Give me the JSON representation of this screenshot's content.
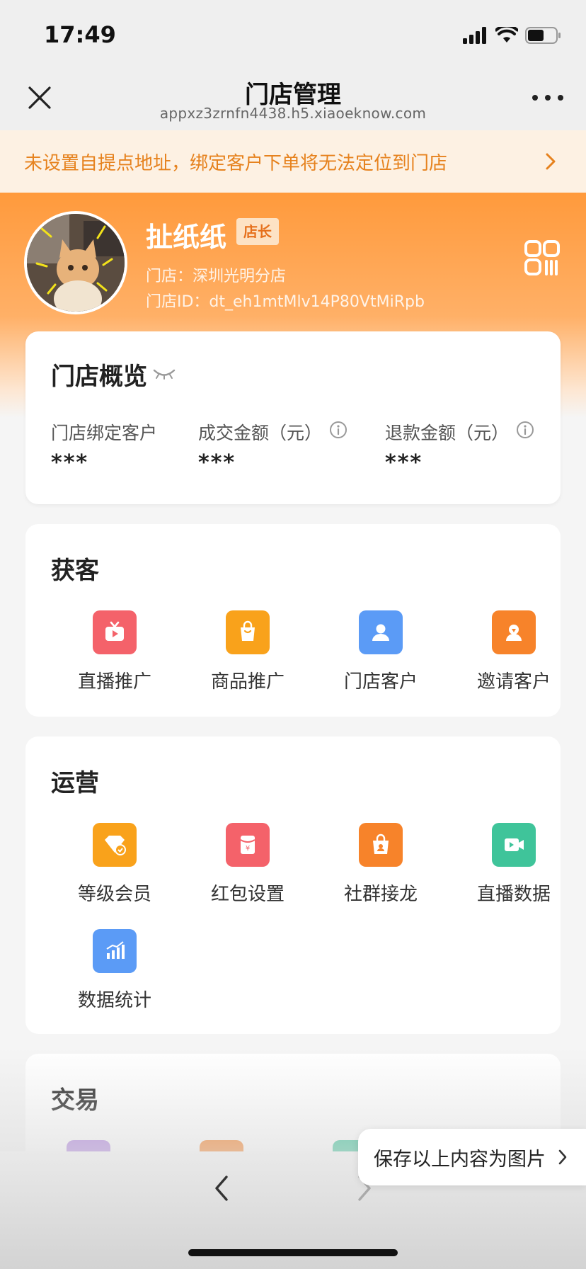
{
  "status_bar": {
    "time": "17:49"
  },
  "nav": {
    "title": "门店管理",
    "subtitle": "appxz3zrnfn4438.h5.xiaoeknow.com"
  },
  "notice": {
    "text": "未设置自提点地址，绑定客户下单将无法定位到门店"
  },
  "profile": {
    "name": "扯纸纸",
    "role": "店长",
    "store": "门店：深圳光明分店",
    "store_id": "门店ID：dt_eh1mtMlv14P80VtMiRpb"
  },
  "overview": {
    "title": "门店概览",
    "metrics": [
      {
        "label": "门店绑定客户",
        "value": "***"
      },
      {
        "label": "成交金额（元）",
        "value": "***"
      },
      {
        "label": "退款金额（元）",
        "value": "***"
      }
    ]
  },
  "sections": {
    "acquire": {
      "title": "获客",
      "items": [
        {
          "label": "直播推广",
          "icon": "live-tv-icon",
          "color": "#f4626a"
        },
        {
          "label": "商品推广",
          "icon": "shopping-bag-icon",
          "color": "#f9a21b"
        },
        {
          "label": "门店客户",
          "icon": "user-icon",
          "color": "#5b9bf6"
        },
        {
          "label": "邀请客户",
          "icon": "invite-user-icon",
          "color": "#f7832a"
        }
      ]
    },
    "operate": {
      "title": "运营",
      "items": [
        {
          "label": "等级会员",
          "icon": "member-diamond-icon",
          "color": "#f9a21b"
        },
        {
          "label": "红包设置",
          "icon": "red-envelope-icon",
          "color": "#f4626a"
        },
        {
          "label": "社群接龙",
          "icon": "community-bag-icon",
          "color": "#f7832a"
        },
        {
          "label": "直播数据",
          "icon": "video-camera-icon",
          "color": "#3fc49a"
        },
        {
          "label": "数据统计",
          "icon": "bar-chart-icon",
          "color": "#5b9bf6"
        }
      ]
    },
    "trade": {
      "title": "交易"
    }
  },
  "save_image": {
    "label": "保存以上内容为图片"
  }
}
